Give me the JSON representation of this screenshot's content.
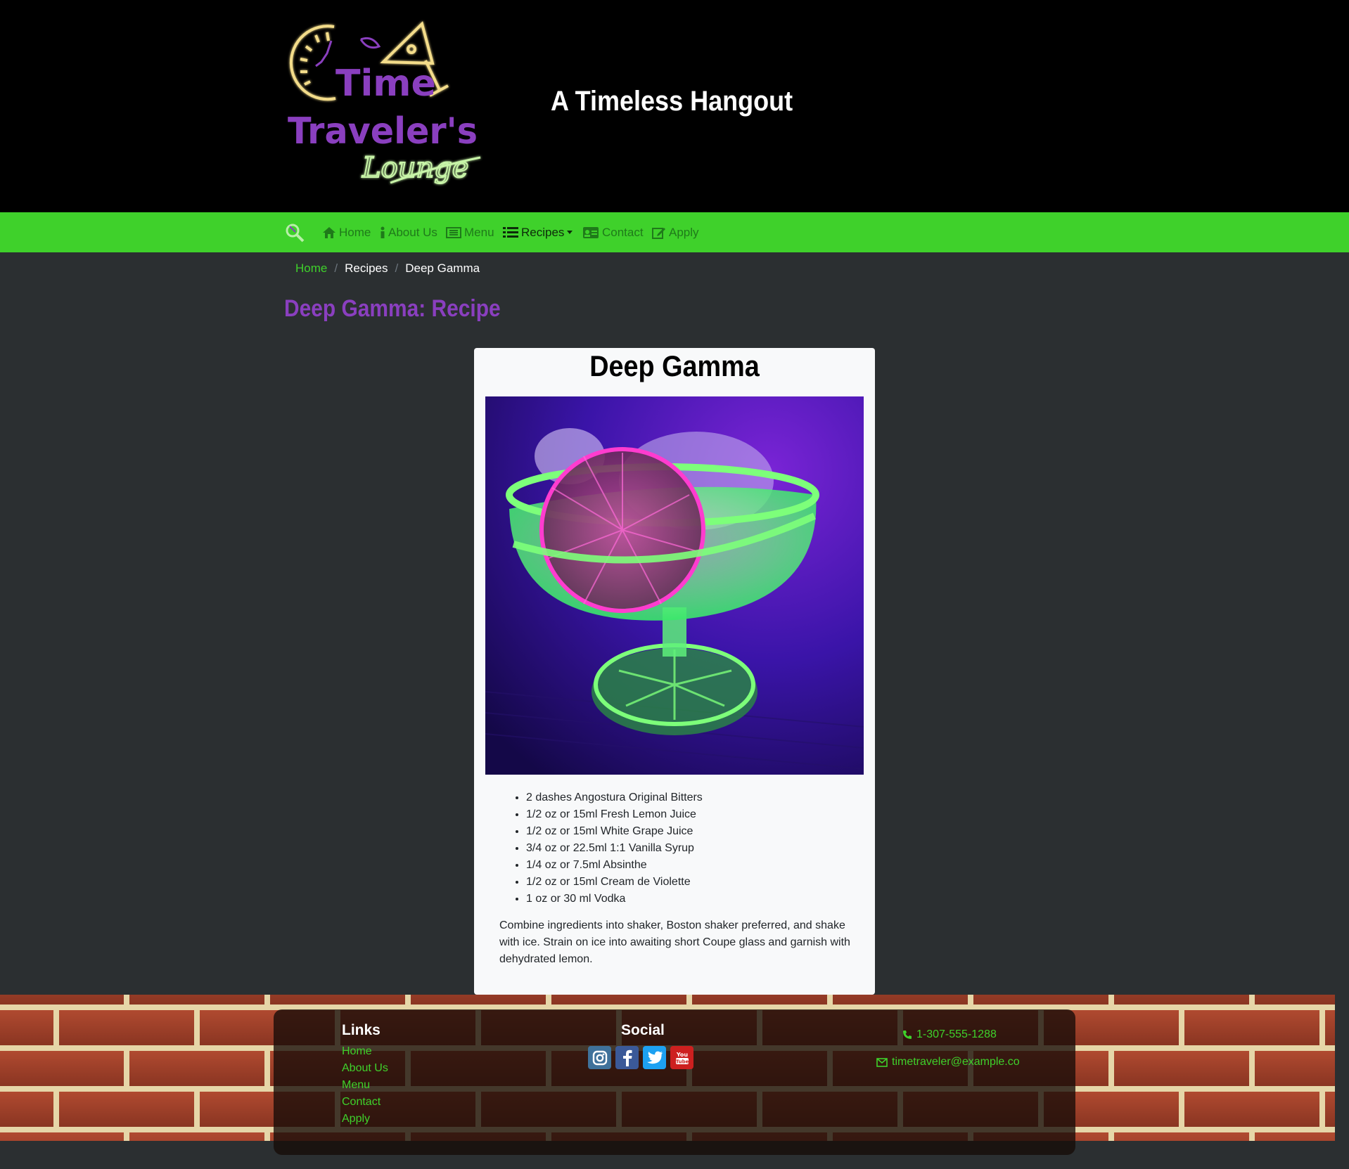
{
  "header": {
    "logo_text": [
      "Time",
      "Traveler's",
      "Lounge"
    ],
    "tagline": "A Timeless Hangout"
  },
  "nav": {
    "items": [
      {
        "label": "Home",
        "icon": "home-icon"
      },
      {
        "label": "About Us",
        "icon": "info-icon"
      },
      {
        "label": "Menu",
        "icon": "menu-list-icon"
      },
      {
        "label": "Recipes",
        "icon": "list-icon",
        "active": true,
        "dropdown": true
      },
      {
        "label": "Contact",
        "icon": "contact-card-icon"
      },
      {
        "label": "Apply",
        "icon": "edit-icon"
      }
    ]
  },
  "breadcrumb": {
    "items": [
      "Home",
      "Recipes",
      "Deep Gamma"
    ]
  },
  "page": {
    "title": "Deep Gamma: Recipe"
  },
  "recipe": {
    "name": "Deep Gamma",
    "ingredients": [
      "2 dashes Angostura Original Bitters",
      "1/2 oz or 15ml Fresh Lemon Juice",
      "1/2 oz or 15ml White Grape Juice",
      "3/4 oz or 22.5ml 1:1 Vanilla Syrup",
      "1/4 oz or 7.5ml Absinthe",
      "1/2 oz or 15ml Cream de Violette",
      "1 oz or 30 ml Vodka"
    ],
    "instructions": "Combine ingredients into shaker, Boston shaker preferred, and shake with ice. Strain on ice into awaiting short Coupe glass and garnish with dehydrated lemon."
  },
  "footer": {
    "links_heading": "Links",
    "links": [
      "Home",
      "About Us",
      "Menu",
      "Contact",
      "Apply"
    ],
    "social_heading": "Social",
    "social": [
      {
        "icon": "instagram-icon",
        "color": "#3f729b"
      },
      {
        "icon": "facebook-icon",
        "color": "#3b5998"
      },
      {
        "icon": "twitter-icon",
        "color": "#1da1f2"
      },
      {
        "icon": "youtube-icon",
        "color": "#cd201f"
      }
    ],
    "phone": "1-307-555-1288",
    "email": "timetraveler@example.co"
  },
  "colors": {
    "accent_green": "#3fd12b",
    "title_purple": "#8a3fbf",
    "page_bg": "#2b2f31",
    "brick": "#9b3d27"
  }
}
